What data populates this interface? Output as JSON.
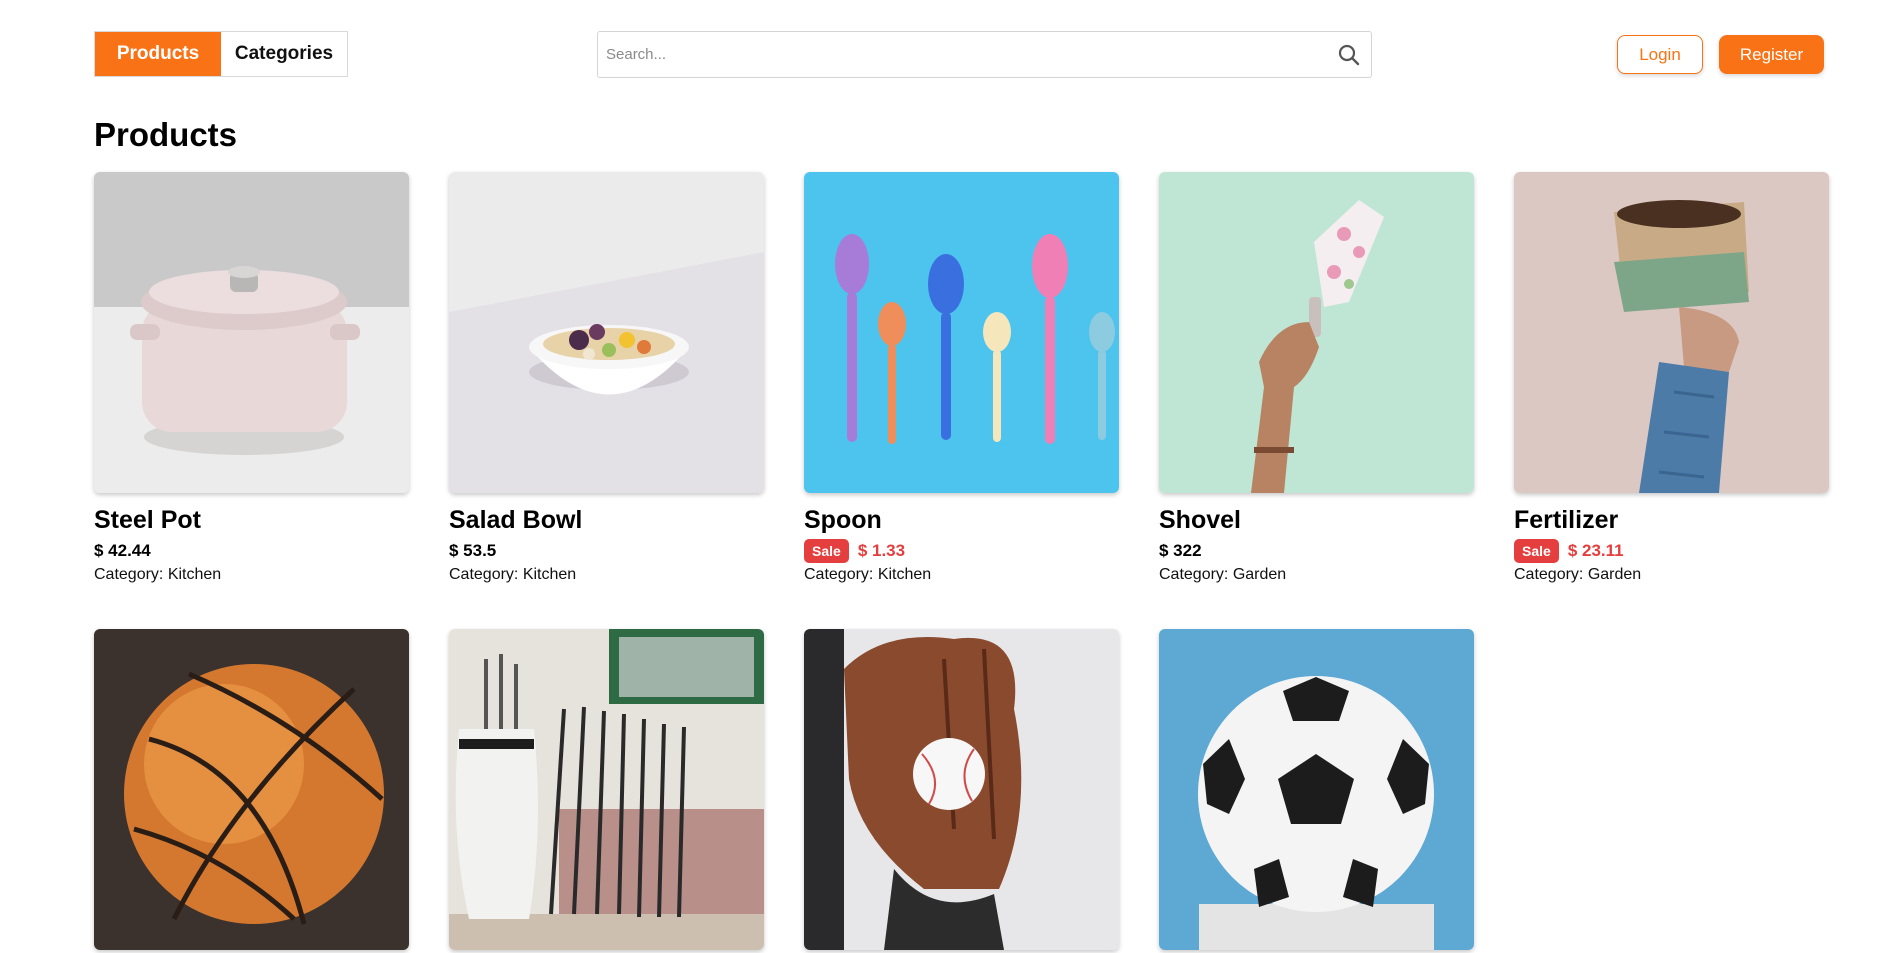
{
  "nav": {
    "products_label": "Products",
    "categories_label": "Categories"
  },
  "search": {
    "placeholder": "Search...",
    "value": ""
  },
  "auth": {
    "login_label": "Login",
    "register_label": "Register"
  },
  "page": {
    "title": "Products"
  },
  "colors": {
    "accent": "#f97316",
    "sale": "#e53e3e"
  },
  "products": [
    {
      "name": "Steel Pot",
      "price": "$ 42.44",
      "sale": false,
      "category": "Category: Kitchen",
      "image": "pot-photo"
    },
    {
      "name": "Salad Bowl",
      "price": "$ 53.5",
      "sale": false,
      "category": "Category: Kitchen",
      "image": "salad-bowl-photo"
    },
    {
      "name": "Spoon",
      "price": "$ 1.33",
      "sale": true,
      "sale_label": "Sale",
      "category": "Category: Kitchen",
      "image": "spoons-photo"
    },
    {
      "name": "Shovel",
      "price": "$ 322",
      "sale": false,
      "category": "Category: Garden",
      "image": "shovel-photo"
    },
    {
      "name": "Fertilizer",
      "price": "$ 23.11",
      "sale": true,
      "sale_label": "Sale",
      "category": "Category: Garden",
      "image": "fertilizer-photo"
    },
    {
      "image": "basketball-photo"
    },
    {
      "image": "golf-clubs-photo"
    },
    {
      "image": "baseball-glove-photo"
    },
    {
      "image": "soccer-ball-photo"
    }
  ]
}
